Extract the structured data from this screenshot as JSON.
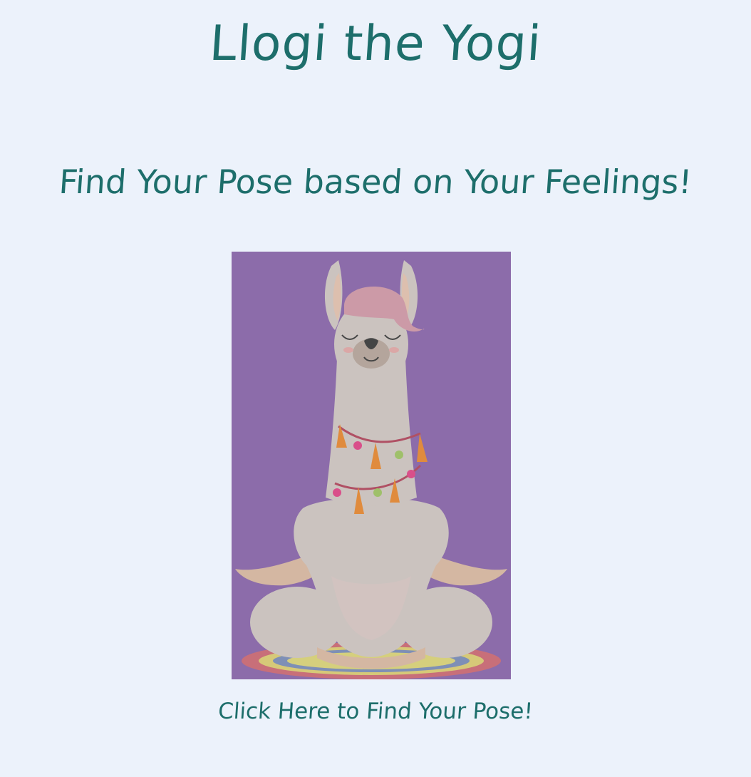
{
  "header": {
    "title": "Llogi the Yogi",
    "subtitle": "Find Your Pose based on Your Feelings!"
  },
  "hero_image": {
    "icon": "yoga-llama-illustration",
    "background_color": "#8c6caa"
  },
  "cta": {
    "label": "Click Here to Find Your Pose!"
  },
  "colors": {
    "page_background": "#ecf2fb",
    "text": "#1d6e6b"
  }
}
